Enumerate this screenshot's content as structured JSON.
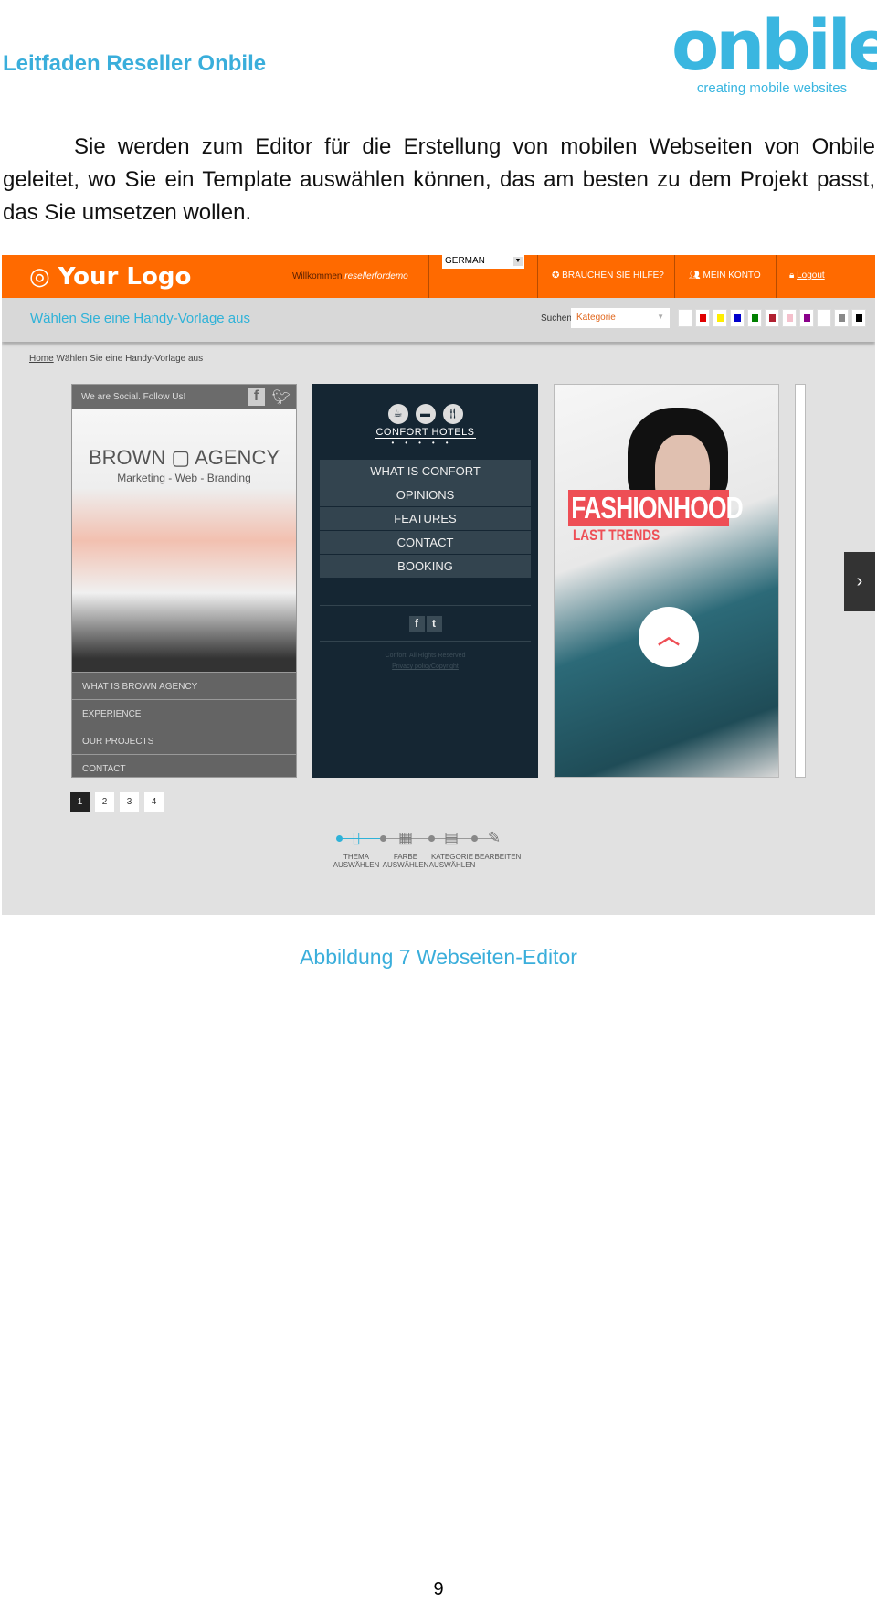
{
  "header": {
    "title": "Leitfaden Reseller Onbile",
    "logo_word": "onbile",
    "logo_tagline": "creating mobile websites"
  },
  "paragraph": "Sie werden zum Editor für die Erstellung von mobilen Webseiten von Onbile geleitet, wo Sie ein Template auswählen können, das am besten zu dem Projekt passt, das Sie umsetzen wollen.",
  "editor": {
    "logo": "◎ Your Logo",
    "welcome": "Willkommen ",
    "username": "resellerfordemo",
    "language": "GERMAN",
    "help": "BRAUCHEN SIE HILFE?",
    "account": "MEIN KONTO",
    "logout": "Logout",
    "accent": "#ff6a00",
    "page_title": "Wählen Sie eine Handy-Vorlage aus",
    "search_label": "Suchen",
    "category_placeholder": "Kategorie",
    "color_swatches": [
      "#ffffff",
      "#e00000",
      "#ffee00",
      "#0000cc",
      "#008000",
      "#b02030",
      "#f4c0cc",
      "#8a008a",
      "#ffffff",
      "#888888",
      "#000000"
    ],
    "breadcrumb": {
      "home": "Home",
      "current": "Wählen Sie eine Handy-Vorlage aus"
    },
    "templates": [
      {
        "social_text": "We are Social. Follow Us!",
        "brand": "BROWN ▢ AGENCY",
        "tagline": "Marketing - Web - Branding",
        "nav": [
          "WHAT IS BROWN AGENCY",
          "EXPERIENCE",
          "OUR PROJECTS",
          "CONTACT"
        ]
      },
      {
        "brand": "CONFORT HOTELS",
        "menu": [
          "WHAT IS CONFORT",
          "OPINIONS",
          "FEATURES",
          "CONTACT",
          "BOOKING"
        ],
        "footer": "Confort. All Rights Reserved",
        "footer_link": "Privacy policyCopyright"
      },
      {
        "title": "FASHIONHOOD",
        "subtitle": "LAST TRENDS"
      }
    ],
    "pages": [
      "1",
      "2",
      "3",
      "4"
    ],
    "current_page": "1",
    "steps": [
      {
        "l1": "THEMA",
        "l2": "AUSWÄHLEN",
        "icon": "phone-icon"
      },
      {
        "l1": "FARBE",
        "l2": "AUSWÄHLEN",
        "icon": "grid-icon"
      },
      {
        "l1": "KATEGORIE",
        "l2": "AUSWÄHLEN",
        "icon": "clipboard-icon"
      },
      {
        "l1": "BEARBEITEN",
        "l2": "",
        "icon": "pencil-icon"
      }
    ]
  },
  "caption": "Abbildung 7 Webseiten-Editor",
  "page_number": "9"
}
